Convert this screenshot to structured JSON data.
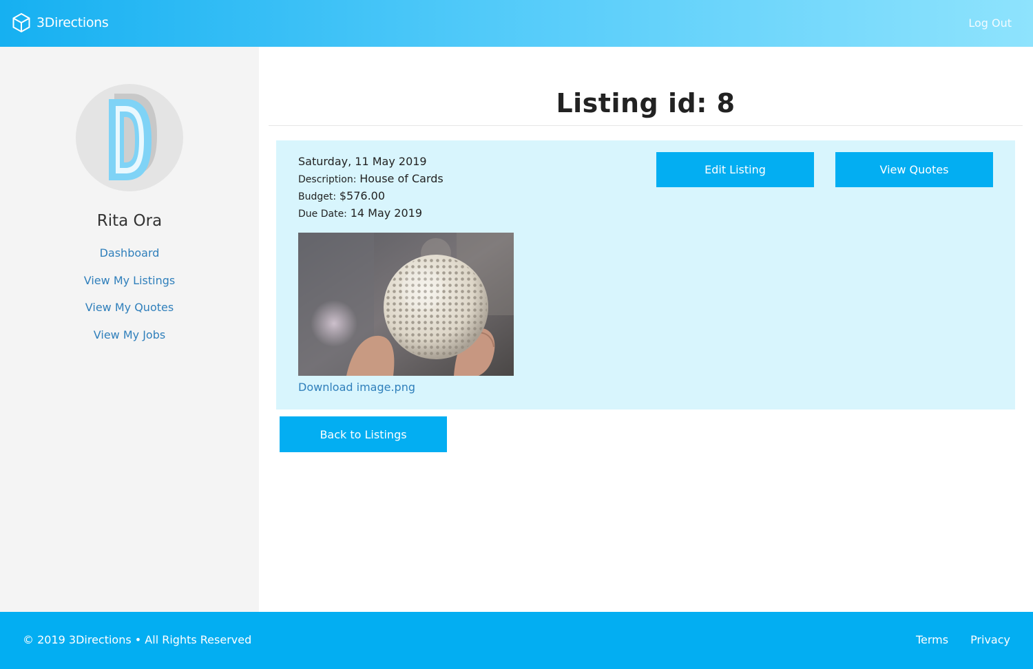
{
  "header": {
    "brand": "3Directions",
    "logo_icon": "cube-logo-icon",
    "logout_label": "Log Out"
  },
  "sidebar": {
    "avatar_letter": "D",
    "user_name": "Rita Ora",
    "nav": [
      {
        "label": "Dashboard"
      },
      {
        "label": "View My Listings"
      },
      {
        "label": "View My Quotes"
      },
      {
        "label": "View My Jobs"
      }
    ]
  },
  "main": {
    "title": "Listing id: 8",
    "listing": {
      "date": "Saturday, 11 May 2019",
      "description_label": "Description:",
      "description": "House of Cards",
      "budget_label": "Budget:",
      "budget": "$576.00",
      "due_label": "Due Date:",
      "due_date": "14 May 2019",
      "image_alt": "3D printed lattice sphere held between fingers",
      "download_label": "Download image.png"
    },
    "buttons": {
      "edit": "Edit Listing",
      "quotes": "View Quotes",
      "back": "Back to Listings"
    }
  },
  "footer": {
    "copyright": "© 2019 3Directions • All Rights Reserved",
    "links": [
      {
        "label": "Terms"
      },
      {
        "label": "Privacy"
      }
    ]
  },
  "colors": {
    "accent": "#03aef2",
    "card_bg": "#d8f5fd",
    "link": "#2f7fbb",
    "sidebar_bg": "#f4f4f4"
  }
}
